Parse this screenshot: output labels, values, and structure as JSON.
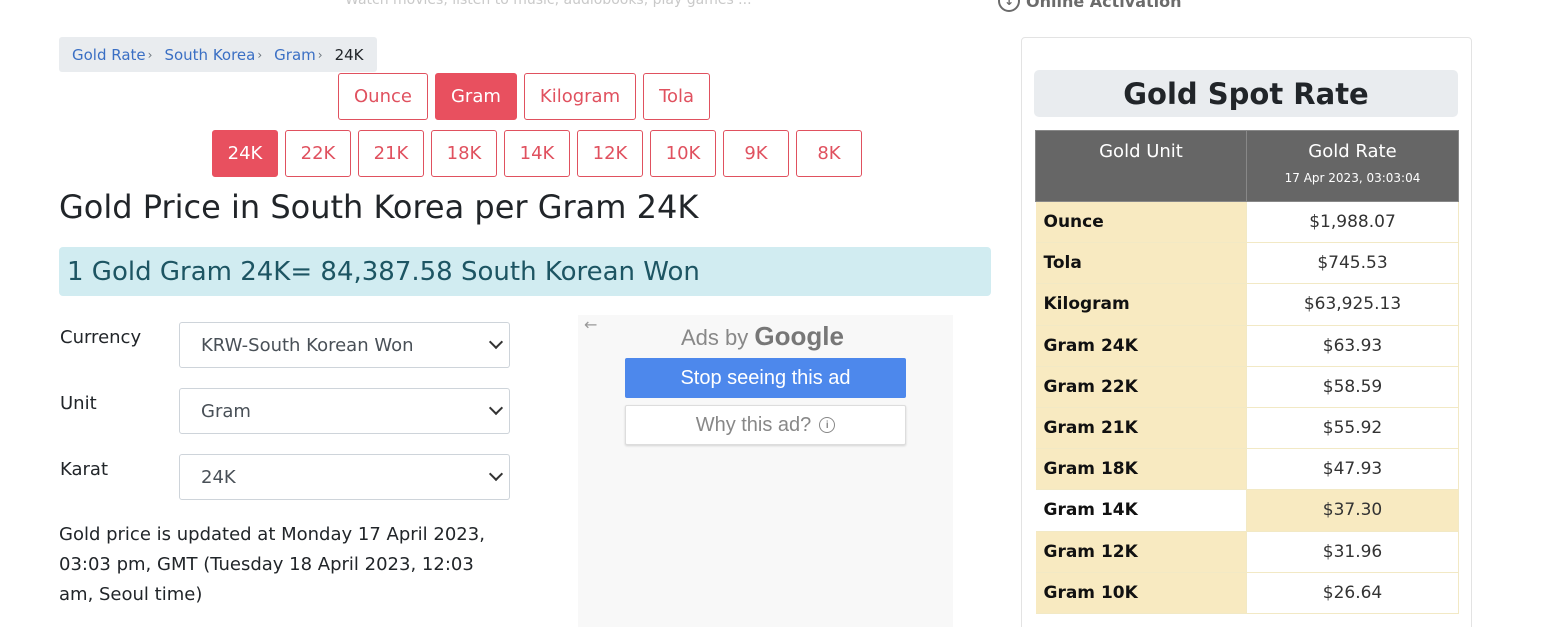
{
  "top": {
    "tagline": "Watch movies, listen to music, audiobooks, play games ...",
    "activation_label": "Online Activation"
  },
  "breadcrumb": {
    "items": [
      "Gold Rate",
      "South Korea",
      "Gram"
    ],
    "current": "24K"
  },
  "unit_buttons": [
    {
      "label": "Ounce",
      "active": false
    },
    {
      "label": "Gram",
      "active": true
    },
    {
      "label": "Kilogram",
      "active": false
    },
    {
      "label": "Tola",
      "active": false
    }
  ],
  "karat_buttons": [
    {
      "label": "24K",
      "active": true
    },
    {
      "label": "22K",
      "active": false
    },
    {
      "label": "21K",
      "active": false
    },
    {
      "label": "18K",
      "active": false
    },
    {
      "label": "14K",
      "active": false
    },
    {
      "label": "12K",
      "active": false
    },
    {
      "label": "10K",
      "active": false
    },
    {
      "label": "9K",
      "active": false
    },
    {
      "label": "8K",
      "active": false
    }
  ],
  "main": {
    "title": "Gold Price in South Korea per Gram 24K",
    "rate_banner": "1 Gold Gram 24K= 84,387.58 South Korean Won"
  },
  "form": {
    "currency_label": "Currency",
    "currency_value": "KRW-South Korean Won",
    "unit_label": "Unit",
    "unit_value": "Gram",
    "karat_label": "Karat",
    "karat_value": "24K"
  },
  "update_note": "Gold price is updated at Monday 17 April 2023, 03:03 pm, GMT (Tuesday 18 April 2023, 12:03 am, Seoul time)",
  "ad": {
    "ads_by": "Ads by",
    "brand": "Google",
    "stop_label": "Stop seeing this ad",
    "why_label": "Why this ad?"
  },
  "spot_rate": {
    "title": "Gold Spot Rate",
    "col_unit": "Gold Unit",
    "col_rate": "Gold Rate",
    "timestamp": "17 Apr 2023, 03:03:04",
    "rows": [
      {
        "unit": "Ounce",
        "rate": "$1,988.07"
      },
      {
        "unit": "Tola",
        "rate": "$745.53"
      },
      {
        "unit": "Kilogram",
        "rate": "$63,925.13"
      },
      {
        "unit": "Gram 24K",
        "rate": "$63.93"
      },
      {
        "unit": "Gram 22K",
        "rate": "$58.59"
      },
      {
        "unit": "Gram 21K",
        "rate": "$55.92"
      },
      {
        "unit": "Gram 18K",
        "rate": "$47.93"
      },
      {
        "unit": "Gram 14K",
        "rate": "$37.30"
      },
      {
        "unit": "Gram 12K",
        "rate": "$31.96"
      },
      {
        "unit": "Gram 10K",
        "rate": "$26.64"
      }
    ]
  },
  "colors": {
    "accent": "#e8505f",
    "banner_bg": "#d1ecf1",
    "table_header": "#666666",
    "table_unit_bg": "#f8eac1",
    "ad_button": "#4d88ec"
  }
}
